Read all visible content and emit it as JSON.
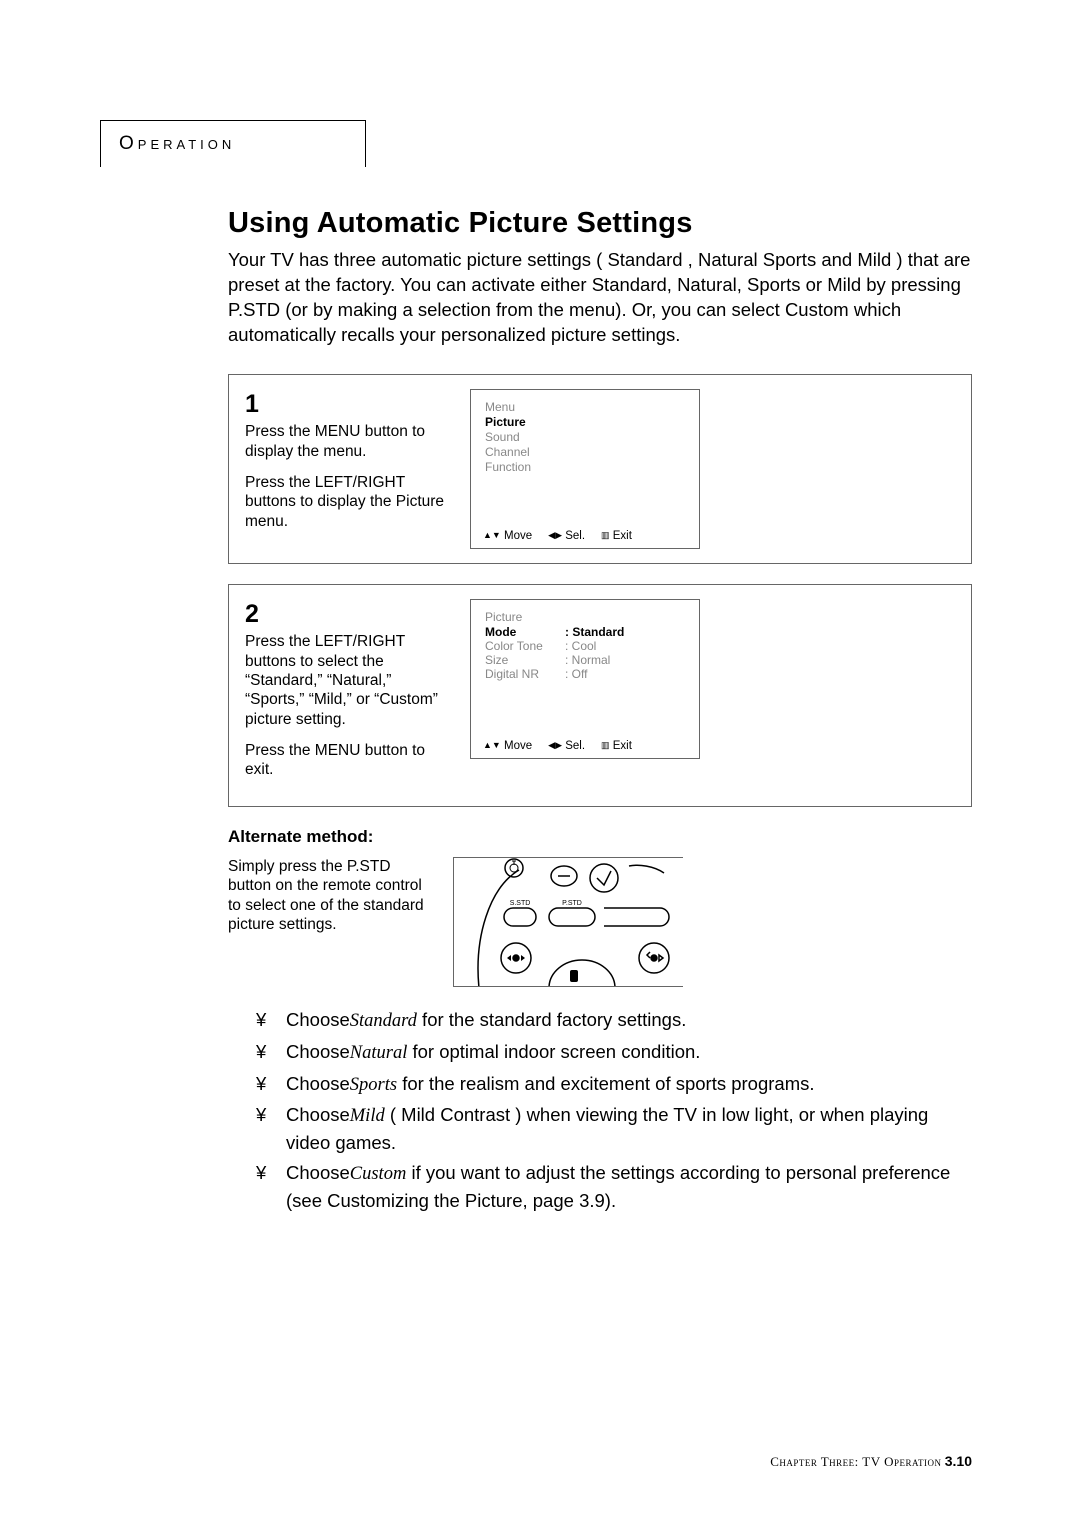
{
  "section_tab": "Operation",
  "title": "Using Automatic Picture Settings",
  "intro": "Your TV has three automatic picture settings ( Standard ,   Natural   Sports  and  Mild ) that are preset at the factory.  You can activate either Standard, Natural, Sports or Mild by pressing P.STD (or by making a selection from the menu). Or, you can select  Custom  which automatically recalls your personalized picture settings.",
  "step1": {
    "num": "1",
    "p1": "Press the MENU button to display the menu.",
    "p2": "Press the LEFT/RIGHT buttons to display the Picture menu.",
    "screen": {
      "title": "Menu",
      "items": [
        "Picture",
        "Sound",
        "Channel",
        "Function"
      ],
      "selected": "Picture",
      "nav_move": "Move",
      "nav_sel": "Sel.",
      "nav_exit": "Exit"
    }
  },
  "step2": {
    "num": "2",
    "p1": "Press the LEFT/RIGHT buttons to select the “Standard,” “Natural,” “Sports,” “Mild,” or “Custom” picture setting.",
    "p2": "Press the MENU button to exit.",
    "screen": {
      "title": "Picture",
      "rows": [
        {
          "k": "Mode",
          "v": ": Standard",
          "sel": true
        },
        {
          "k": "Color Tone",
          "v": ": Cool"
        },
        {
          "k": "Size",
          "v": ": Normal"
        },
        {
          "k": "Digital NR",
          "v": ": Off"
        }
      ],
      "nav_move": "Move",
      "nav_sel": "Sel.",
      "nav_exit": "Exit"
    }
  },
  "alt_heading": "Alternate method:",
  "alt_text": "Simply press the P.STD button on the remote control to select one of the standard picture settings.",
  "remote_labels": {
    "sstd": "S.STD",
    "pstd": "P.STD"
  },
  "choices": [
    {
      "pre": "Choose",
      "em": "Standard",
      "post": " for the standard factory settings."
    },
    {
      "pre": "Choose",
      "em": "Natural",
      "post": " for optimal indoor screen condition."
    },
    {
      "pre": "Choose",
      "em": "Sports",
      "post": " for the realism and excitement of sports programs."
    },
    {
      "pre": "Choose",
      "em": "Mild",
      "post": " ( Mild Contrast ) when viewing the TV in low light, or when playing video games."
    },
    {
      "pre": "Choose",
      "em": "Custom",
      "post": " if you want to adjust the settings according to personal preference (see  Customizing the Picture, page 3.9)."
    }
  ],
  "footer": {
    "chapter_sc": "Chapter",
    "three_sc": "Three: TV Operation",
    "pg": "3.10"
  }
}
